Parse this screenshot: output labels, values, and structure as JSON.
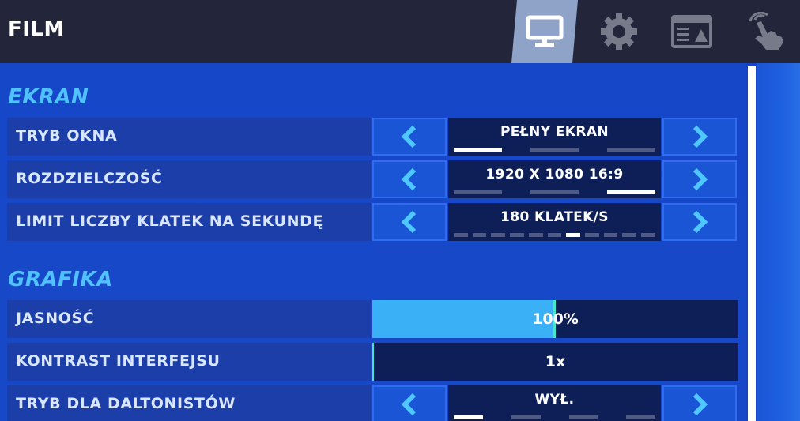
{
  "header": {
    "title": "FILM",
    "tabs": [
      {
        "name": "video",
        "icon": "monitor-icon",
        "active": true
      },
      {
        "name": "settings",
        "icon": "gear-icon",
        "active": false
      },
      {
        "name": "hud",
        "icon": "hud-layout-icon",
        "active": false
      },
      {
        "name": "touch",
        "icon": "touch-hand-icon",
        "active": false
      }
    ]
  },
  "sections": {
    "ekran": {
      "title": "EKRAN",
      "rows": [
        {
          "label": "TRYB OKNA",
          "value": "PEŁNY EKRAN",
          "option_count": 3,
          "selected_index": 0
        },
        {
          "label": "ROZDZIELCZOŚĆ",
          "value": "1920 X 1080 16:9",
          "option_count": 3,
          "selected_index": 2
        },
        {
          "label": "LIMIT LICZBY KLATEK NA SEKUNDĘ",
          "value": "180 KLATEK/S",
          "option_count": 11,
          "selected_index": 6
        }
      ]
    },
    "grafika": {
      "title": "GRAFIKA",
      "rows": [
        {
          "label": "JASNOŚĆ",
          "value": "100%",
          "fill": 0.5
        },
        {
          "label": "KONTRAST INTERFEJSU",
          "value": "1x",
          "fill": 0
        },
        {
          "label": "TRYB DLA DALTONISTÓW",
          "value": "WYŁ.",
          "option_count": 4,
          "selected_index": 0
        }
      ]
    }
  },
  "colors": {
    "background": "#1546c6",
    "topbar": "#23263b",
    "section_title": "#4fc2ff",
    "slider_fill": "#3ab1f6",
    "slider_edge": "#47e6d2",
    "value_box": "#0e1e57"
  }
}
